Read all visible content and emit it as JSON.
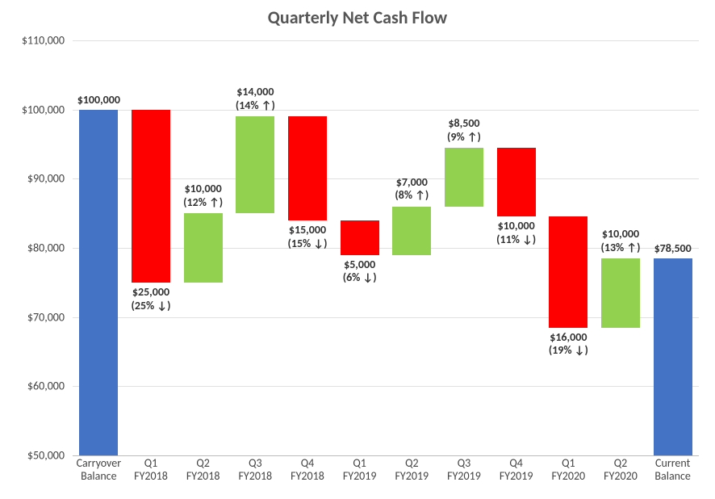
{
  "chart_data": {
    "type": "bar",
    "subtype": "waterfall",
    "title": "Quarterly Net Cash Flow",
    "xlabel": "",
    "ylabel": "",
    "ylim": [
      50000,
      110000
    ],
    "yticks": [
      50000,
      60000,
      70000,
      80000,
      90000,
      100000,
      110000
    ],
    "ytick_labels": [
      "$50,000",
      "$60,000",
      "$70,000",
      "$80,000",
      "$90,000",
      "$100,000",
      "$110,000"
    ],
    "categories": [
      "Carryover Balance",
      "Q1 FY2018",
      "Q2 FY2018",
      "Q3 FY2018",
      "Q4 FY2018",
      "Q1 FY2019",
      "Q2 FY2019",
      "Q3 FY2019",
      "Q4 FY2019",
      "Q1 FY2020",
      "Q2 FY2020",
      "Current Balance"
    ],
    "category_lines": [
      [
        "Carryover",
        "Balance"
      ],
      [
        "Q1",
        "FY2018"
      ],
      [
        "Q2",
        "FY2018"
      ],
      [
        "Q3",
        "FY2018"
      ],
      [
        "Q4",
        "FY2018"
      ],
      [
        "Q1",
        "FY2019"
      ],
      [
        "Q2",
        "FY2019"
      ],
      [
        "Q3",
        "FY2019"
      ],
      [
        "Q4",
        "FY2019"
      ],
      [
        "Q1",
        "FY2020"
      ],
      [
        "Q2",
        "FY2020"
      ],
      [
        "Current",
        "Balance"
      ]
    ],
    "colors": {
      "start": "#4472c4",
      "end": "#4472c4",
      "increase": "#92d050",
      "decrease": "#ff0000"
    },
    "series": [
      {
        "label": "Carryover Balance",
        "kind": "start",
        "value": 100000,
        "start": 50000,
        "end": 100000
      },
      {
        "label": "Q1 FY2018",
        "kind": "decrease",
        "value": -25000,
        "start": 100000,
        "end": 75000,
        "data_label": "$25,000",
        "pct_label": "(25% ↓)"
      },
      {
        "label": "Q2 FY2018",
        "kind": "increase",
        "value": 10000,
        "start": 75000,
        "end": 85000,
        "data_label": "$10,000",
        "pct_label": "(12% ↑)"
      },
      {
        "label": "Q3 FY2018",
        "kind": "increase",
        "value": 14000,
        "start": 85000,
        "end": 99000,
        "data_label": "$14,000",
        "pct_label": "(14% ↑)"
      },
      {
        "label": "Q4 FY2018",
        "kind": "decrease",
        "value": -15000,
        "start": 99000,
        "end": 84000,
        "data_label": "$15,000",
        "pct_label": "(15% ↓)"
      },
      {
        "label": "Q1 FY2019",
        "kind": "decrease",
        "value": -5000,
        "start": 84000,
        "end": 79000,
        "data_label": "$5,000",
        "pct_label": "(6% ↓)"
      },
      {
        "label": "Q2 FY2019",
        "kind": "increase",
        "value": 7000,
        "start": 79000,
        "end": 86000,
        "data_label": "$7,000",
        "pct_label": "(8% ↑)"
      },
      {
        "label": "Q3 FY2019",
        "kind": "increase",
        "value": 8500,
        "start": 86000,
        "end": 94500,
        "data_label": "$8,500",
        "pct_label": "(9% ↑)"
      },
      {
        "label": "Q4 FY2019",
        "kind": "decrease",
        "value": -10000,
        "start": 94500,
        "end": 84500,
        "data_label": "$10,000",
        "pct_label": "(11% ↓)"
      },
      {
        "label": "Q1 FY2020",
        "kind": "decrease",
        "value": -16000,
        "start": 84500,
        "end": 68500,
        "data_label": "$16,000",
        "pct_label": "(19% ↓)"
      },
      {
        "label": "Q2 FY2020",
        "kind": "increase",
        "value": 10000,
        "start": 68500,
        "end": 78500,
        "data_label": "$10,000",
        "pct_label": "(13% ↑)"
      },
      {
        "label": "Current Balance",
        "kind": "end",
        "value": 78500,
        "start": 50000,
        "end": 78500,
        "data_label": "$78,500"
      }
    ],
    "endpoints": {
      "start_label": "$100,000",
      "end_label": "$78,500"
    }
  }
}
